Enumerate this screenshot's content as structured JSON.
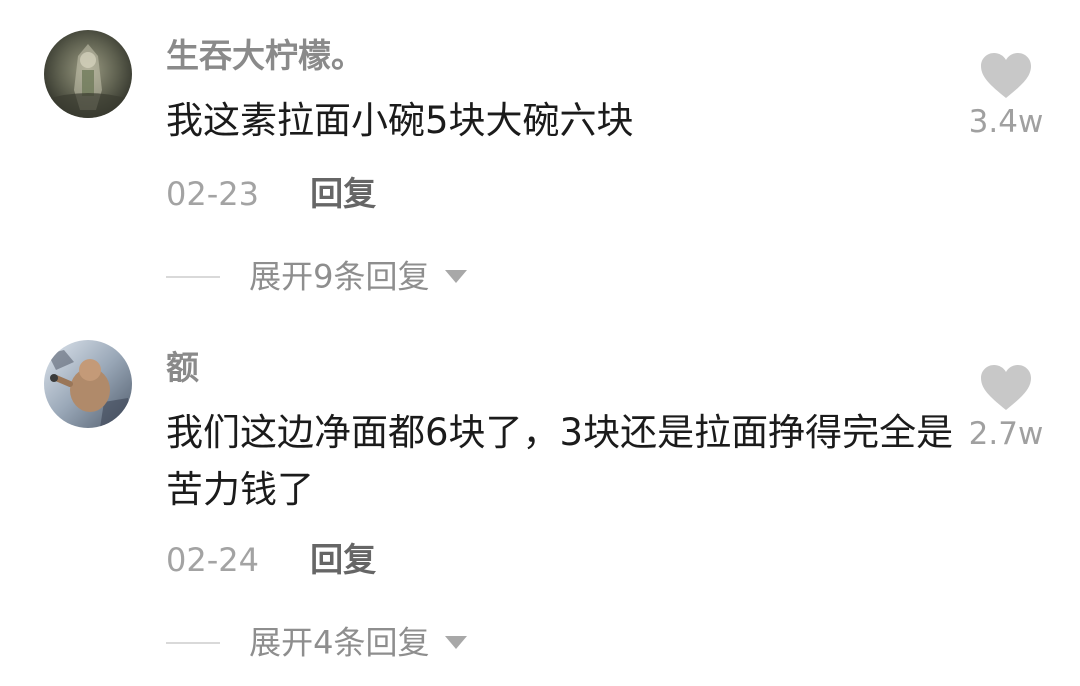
{
  "comments": [
    {
      "username": "生吞大柠檬。",
      "text": "我这素拉面小碗5块大碗六块",
      "date": "02-23",
      "reply_label": "回复",
      "like_count": "3.4w",
      "expand_label": "展开9条回复",
      "avatar_icon": "avatar-icon",
      "like_icon": "heart-icon",
      "expand_icon": "chevron-down-icon"
    },
    {
      "username": "额",
      "text": "我们这边净面都6块了，3块还是拉面挣得完全是苦力钱了",
      "date": "02-24",
      "reply_label": "回复",
      "like_count": "2.7w",
      "expand_label": "展开4条回复",
      "avatar_icon": "avatar-icon",
      "like_icon": "heart-icon",
      "expand_icon": "chevron-down-icon"
    }
  ],
  "colors": {
    "username": "#8a8a8a",
    "text": "#1b1b1b",
    "date": "#a3a3a3",
    "reply": "#666666",
    "heart": "#c8c8c8",
    "background": "#ffffff"
  }
}
